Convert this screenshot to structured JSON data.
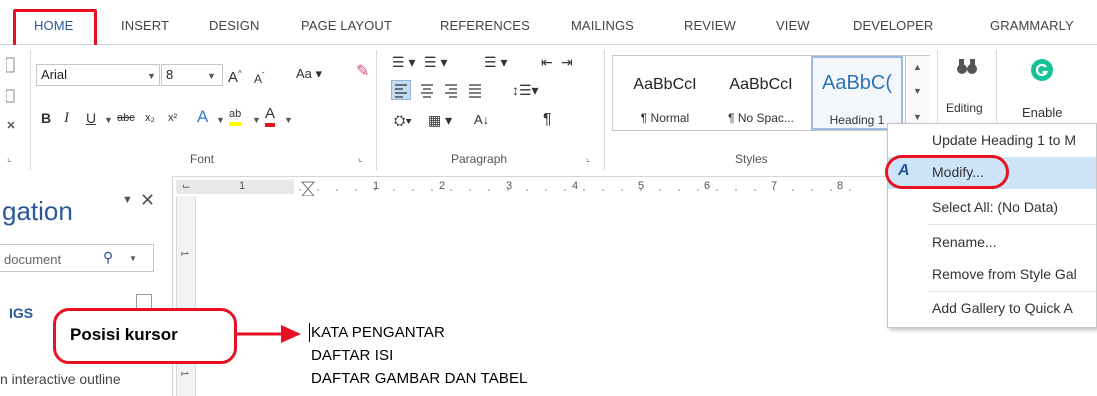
{
  "tabs": [
    "HOME",
    "INSERT",
    "DESIGN",
    "PAGE LAYOUT",
    "REFERENCES",
    "MAILINGS",
    "REVIEW",
    "VIEW",
    "DEVELOPER",
    "GRAMMARLY"
  ],
  "font": {
    "family": "Arial",
    "size": "8",
    "group_label": "Font"
  },
  "paragraph": {
    "group_label": "Paragraph"
  },
  "styles": {
    "group_label": "Styles",
    "items": [
      {
        "sample": "AaBbCcI",
        "name": "¶ Normal"
      },
      {
        "sample": "AaBbCcI",
        "name": "¶ No Spac..."
      },
      {
        "sample": "AaBbC(",
        "name": "Heading 1"
      }
    ]
  },
  "editing": {
    "label": "Editing"
  },
  "grammarly": {
    "label": "Enable"
  },
  "ruler": {
    "numbers": [
      "1",
      "1",
      "2",
      "3",
      "4",
      "5",
      "6",
      "7",
      "8"
    ]
  },
  "vruler": {
    "numbers": [
      "1",
      "1"
    ]
  },
  "nav_pane": {
    "title": "gation",
    "search_placeholder": "document",
    "tab": "IGS",
    "text": "n interactive outline"
  },
  "context_menu": {
    "items": [
      "Update Heading 1 to M",
      "Modify...",
      "Select All: (No Data)",
      "Rename...",
      "Remove from Style Gal",
      "Add Gallery to Quick A"
    ]
  },
  "document": {
    "lines": [
      "KATA PENGANTAR",
      "DAFTAR ISI",
      "DAFTAR GAMBAR DAN TABEL"
    ]
  },
  "callout": {
    "text": "Posisi kursor"
  },
  "colors": {
    "accent": "#2b579a",
    "highlight_red": "#e81123",
    "grammarly_green": "#15c39a"
  }
}
